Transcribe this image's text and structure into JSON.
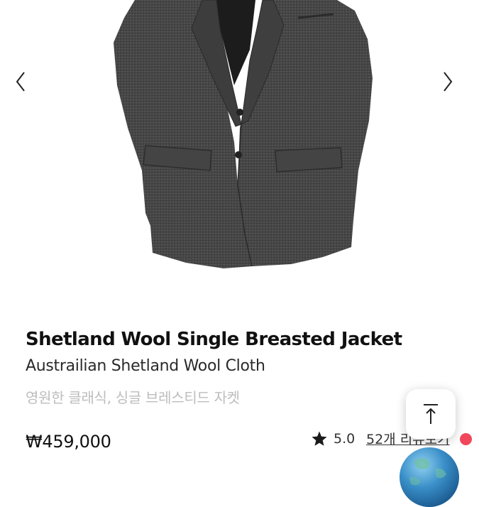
{
  "product": {
    "name": "Shetland Wool Single Breasted Jacket",
    "subtitle": "Austrailian Shetland Wool Cloth",
    "description": "영원한 클래식, 싱글 브레스티드 자켓",
    "price": "₩459,000",
    "rating": "5.0",
    "reviews_link": "52개 리뷰보기"
  },
  "gallery": {
    "prev_icon": "chevron-left-icon",
    "next_icon": "chevron-right-icon",
    "image": "charcoal-wool-jacket-photo"
  },
  "icons": {
    "star": "star-icon",
    "scroll_top": "arrow-up-to-top-icon",
    "floating_widget": "globe-icon"
  },
  "colors": {
    "new_dot": "#f0475a",
    "jacket": "#4a4a4a",
    "muted_text": "#bdbdbd"
  }
}
